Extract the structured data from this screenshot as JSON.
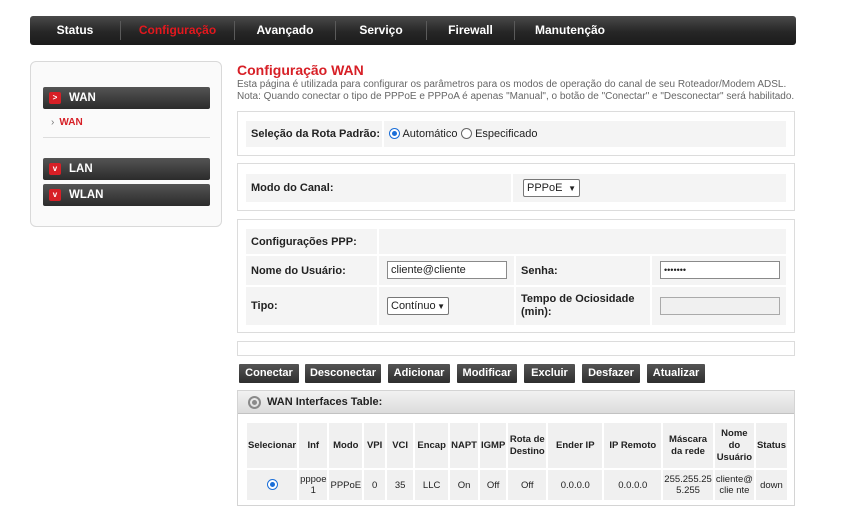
{
  "nav": {
    "items": [
      {
        "label": "Status",
        "active": false
      },
      {
        "label": "Configuração",
        "active": true
      },
      {
        "label": "Avançado",
        "active": false
      },
      {
        "label": "Serviço",
        "active": false
      },
      {
        "label": "Firewall",
        "active": false
      },
      {
        "label": "Manutenção",
        "active": false
      }
    ]
  },
  "sidebar": {
    "wan_header": "WAN",
    "wan_sub": "WAN",
    "lan_header": "LAN",
    "wlan_header": "WLAN"
  },
  "page": {
    "title": "Configuração WAN",
    "description": "Esta página é utilizada para configurar os parâmetros para os modos de operação do canal de seu Roteador/Modem ADSL. Nota: Quando conectar o tipo de PPPoE e PPPoA é apenas \"Manual\", o botão de \"Conectar\" e \"Desconectar\" será habilitado."
  },
  "route": {
    "label": "Seleção da Rota Padrão:",
    "option_auto": "Automático",
    "option_specific": "Especificado",
    "selected": "Automático"
  },
  "channel": {
    "label": "Modo do Canal:",
    "value": "PPPoE"
  },
  "ppp": {
    "section_label": "Configurações PPP:",
    "username_label": "Nome do Usuário:",
    "username_value": "cliente@cliente",
    "password_label": "Senha:",
    "password_value": "•••••••",
    "type_label": "Tipo:",
    "type_value": "Contínuo",
    "idle_label": "Tempo de Ociosidade (min):",
    "idle_value": ""
  },
  "buttons": {
    "connect": "Conectar",
    "disconnect": "Desconectar",
    "add": "Adicionar",
    "modify": "Modificar",
    "delete": "Excluir",
    "undo": "Desfazer",
    "refresh": "Atualizar"
  },
  "wan_table": {
    "title": "WAN Interfaces Table:",
    "headers": [
      "Selecionar",
      "Inf",
      "Modo",
      "VPI",
      "VCI",
      "Encap",
      "NAPT",
      "IGMP",
      "Rota de Destino",
      "Ender IP",
      "IP Remoto",
      "Máscara da rede",
      "Nome do Usuário",
      "Status"
    ],
    "rows": [
      {
        "inf": "pppoe 1",
        "mode": "PPPoE",
        "vpi": "0",
        "vci": "35",
        "encap": "LLC",
        "napt": "On",
        "igmp": "Off",
        "route": "Off",
        "ip": "0.0.0.0",
        "remote": "0.0.0.0",
        "mask": "255.255.25 5.255",
        "user": "cliente@ clie nte",
        "status": "down"
      }
    ]
  },
  "colors": {
    "accent": "#d71f26",
    "nav_bg": "#262626"
  }
}
